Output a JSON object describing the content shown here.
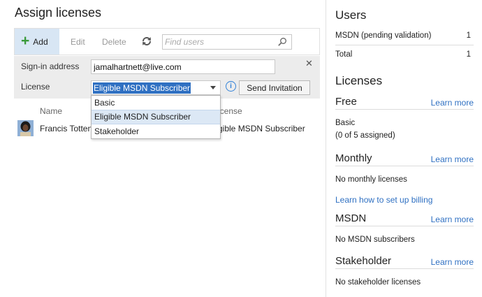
{
  "left": {
    "title": "Assign licenses",
    "toolbar": {
      "add_label": "Add",
      "edit_label": "Edit",
      "delete_label": "Delete",
      "search_placeholder": "Find users"
    },
    "add_panel": {
      "signin_label": "Sign-in address",
      "email_value": "jamalhartnett@live.com",
      "license_label": "License",
      "license_selected": "Eligible MSDN Subscriber",
      "send_label": "Send Invitation",
      "dropdown_options": [
        "Basic",
        "Eligible MSDN Subscriber",
        "Stakeholder"
      ]
    },
    "grid": {
      "col_name": "Name",
      "col_license": "License",
      "col_license_visible": "icense",
      "rows": [
        {
          "name": "Francis Totten",
          "license": "Eligible MSDN Subscriber",
          "license_visible": "gible MSDN Subscriber"
        }
      ]
    }
  },
  "right": {
    "users_title": "Users",
    "users_rows": [
      {
        "label": "MSDN (pending validation)",
        "count": "1"
      },
      {
        "label": "Total",
        "count": "1"
      }
    ],
    "licenses_title": "Licenses",
    "free": {
      "title": "Free",
      "link": "Learn more",
      "line1": "Basic",
      "line2": "(0 of 5 assigned)"
    },
    "monthly": {
      "title": "Monthly",
      "link": "Learn more",
      "text": "No monthly licenses",
      "billing_link": "Learn how to set up billing"
    },
    "msdn": {
      "title": "MSDN",
      "link": "Learn more",
      "text": "No MSDN subscribers"
    },
    "stakeholder": {
      "title": "Stakeholder",
      "link": "Learn more",
      "text": "No stakeholder licenses"
    }
  },
  "colors": {
    "accent": "#2f70c2",
    "add_bg": "#d8e6f4",
    "panel_bg": "#ececec",
    "plus_green": "#3a9a3a"
  },
  "icons": {
    "add": "plus-icon",
    "refresh": "refresh-icon",
    "search": "search-icon",
    "close": "close-icon",
    "info": "info-icon",
    "dropdown": "chevron-down-icon"
  }
}
